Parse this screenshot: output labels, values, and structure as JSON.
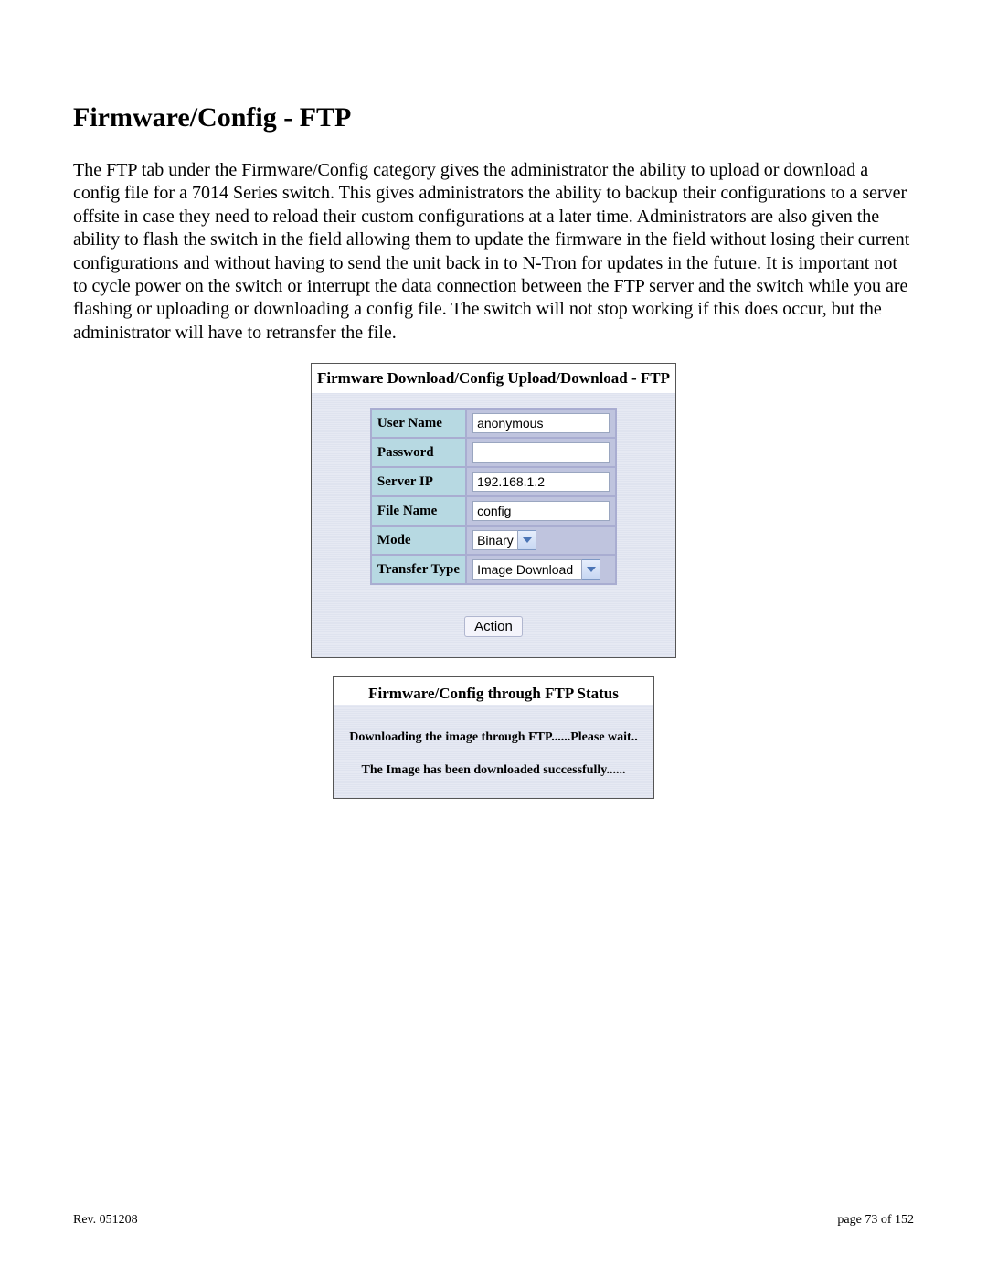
{
  "title": "Firmware/Config - FTP",
  "body_paragraph": "The FTP tab under the Firmware/Config category gives the administrator the ability to upload or download a config file for a 7014 Series switch.  This gives administrators the ability to backup their configurations to a server offsite in case they need to reload their custom configurations at a later time.  Administrators are also given the ability to flash the switch in the field allowing them to update the firmware in the field without losing their current configurations and without having to send the unit back in to N-Tron for updates in the future.  It is important not to cycle power on the switch or interrupt the data connection between the FTP server and the switch while you are flashing or uploading or downloading a config file.  The switch will not stop working if this does occur, but the administrator will have to retransfer the file.",
  "ftp_panel": {
    "title": "Firmware Download/Config Upload/Download - FTP",
    "fields": {
      "user_name": {
        "label": "User Name",
        "value": "anonymous"
      },
      "password": {
        "label": "Password",
        "value": ""
      },
      "server_ip": {
        "label": "Server IP",
        "value": "192.168.1.2"
      },
      "file_name": {
        "label": "File Name",
        "value": "config"
      },
      "mode": {
        "label": "Mode",
        "value": "Binary"
      },
      "transfer_type": {
        "label": "Transfer Type",
        "value": "Image Download"
      }
    },
    "action_label": "Action"
  },
  "status_panel": {
    "title": "Firmware/Config through FTP Status",
    "line1": "Downloading the image through FTP......Please wait..",
    "line2": "The Image has been downloaded successfully......"
  },
  "footer": {
    "rev": "Rev.  051208",
    "page": "page 73 of 152"
  }
}
